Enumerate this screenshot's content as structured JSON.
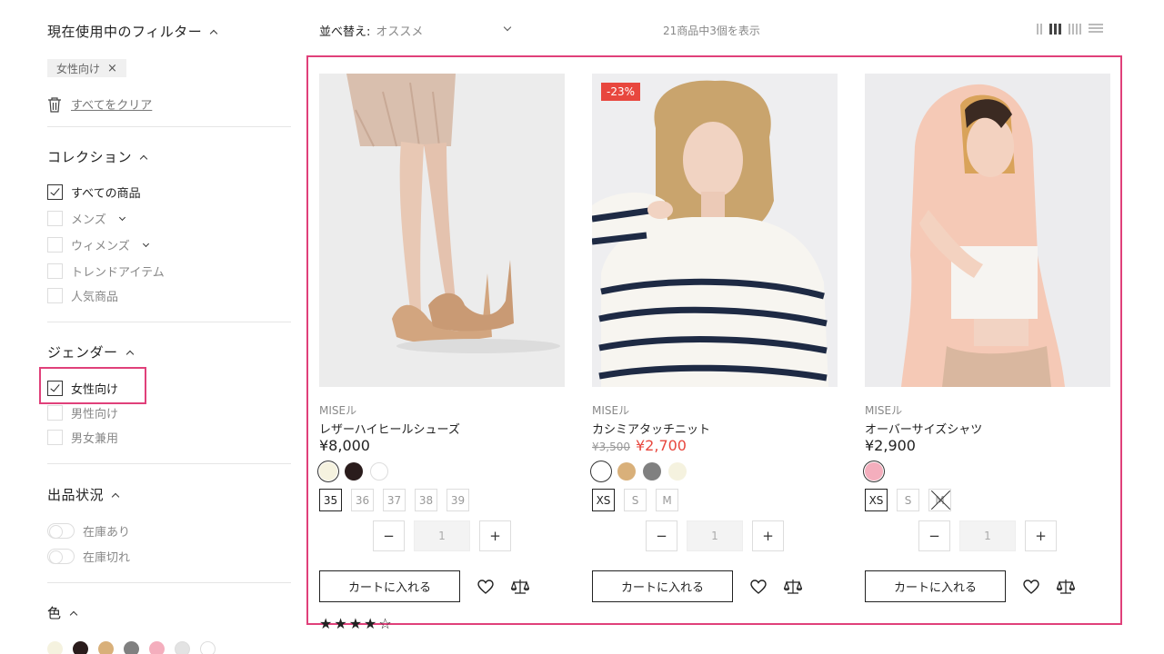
{
  "sidebar": {
    "active_filters": {
      "title": "現在使用中のフィルター",
      "tag": "女性向け",
      "tag_remove": "×",
      "clear_all": "すべてをクリア"
    },
    "collection": {
      "title": "コレクション",
      "items": [
        {
          "label": "すべての商品",
          "checked": true
        },
        {
          "label": "メンズ",
          "checked": false
        },
        {
          "label": "ウィメンズ",
          "checked": false
        },
        {
          "label": "トレンドアイテム",
          "checked": false
        },
        {
          "label": "人気商品",
          "checked": false
        }
      ]
    },
    "gender": {
      "title": "ジェンダー",
      "items": [
        {
          "label": "女性向け",
          "checked": true
        },
        {
          "label": "男性向け",
          "checked": false
        },
        {
          "label": "男女兼用",
          "checked": false
        }
      ]
    },
    "stock": {
      "title": "出品状況",
      "items": [
        {
          "label": "在庫あり",
          "on": false
        },
        {
          "label": "在庫切れ",
          "on": false
        }
      ]
    },
    "color": {
      "title": "色",
      "swatches": [
        "#f5f2df",
        "#2a1c1c",
        "#d9b07a",
        "#808080",
        "#f4aebd",
        "#e3e3e3",
        "#ffffff"
      ]
    }
  },
  "toolbar": {
    "sort_label": "並べ替え:",
    "sort_value": "オススメ",
    "result_count": "21商品中3個を表示"
  },
  "products": [
    {
      "brand": "MISEル",
      "name": "レザーハイヒールシューズ",
      "price": "¥8,000",
      "old_price": "",
      "sale_badge": "",
      "colors": [
        {
          "hex": "#f5f2df",
          "selected": true
        },
        {
          "hex": "#2a1c1c",
          "selected": false
        },
        {
          "hex": "#ffffff",
          "selected": false
        }
      ],
      "sizes": [
        {
          "label": "35",
          "selected": true,
          "unavailable": false
        },
        {
          "label": "36",
          "selected": false,
          "unavailable": false
        },
        {
          "label": "37",
          "selected": false,
          "unavailable": false
        },
        {
          "label": "38",
          "selected": false,
          "unavailable": false
        },
        {
          "label": "39",
          "selected": false,
          "unavailable": false
        }
      ],
      "quantity": "1",
      "cart_label": "カートに入れる"
    },
    {
      "brand": "MISEル",
      "name": "カシミアタッチニット",
      "price": "¥2,700",
      "old_price": "¥3,500",
      "sale_badge": "-23%",
      "colors": [
        {
          "hex": "#ffffff",
          "selected": true
        },
        {
          "hex": "#d9b07a",
          "selected": false
        },
        {
          "hex": "#808080",
          "selected": false
        },
        {
          "hex": "#f5f2df",
          "selected": false
        }
      ],
      "sizes": [
        {
          "label": "XS",
          "selected": true,
          "unavailable": false
        },
        {
          "label": "S",
          "selected": false,
          "unavailable": false
        },
        {
          "label": "M",
          "selected": false,
          "unavailable": false
        }
      ],
      "quantity": "1",
      "cart_label": "カートに入れる"
    },
    {
      "brand": "MISEル",
      "name": "オーバーサイズシャツ",
      "price": "¥2,900",
      "old_price": "",
      "sale_badge": "",
      "colors": [
        {
          "hex": "#f4aebd",
          "selected": true
        }
      ],
      "sizes": [
        {
          "label": "XS",
          "selected": true,
          "unavailable": false
        },
        {
          "label": "S",
          "selected": false,
          "unavailable": false
        },
        {
          "label": "M",
          "selected": false,
          "unavailable": true
        }
      ],
      "quantity": "1",
      "cart_label": "カートに入れる"
    }
  ],
  "qty_minus": "−",
  "qty_plus": "+",
  "rating": {
    "stars": "★★★★☆",
    "value": 4,
    "max": 5
  },
  "colors": {
    "accent_highlight": "#e0407a",
    "sale": "#e8473e"
  }
}
